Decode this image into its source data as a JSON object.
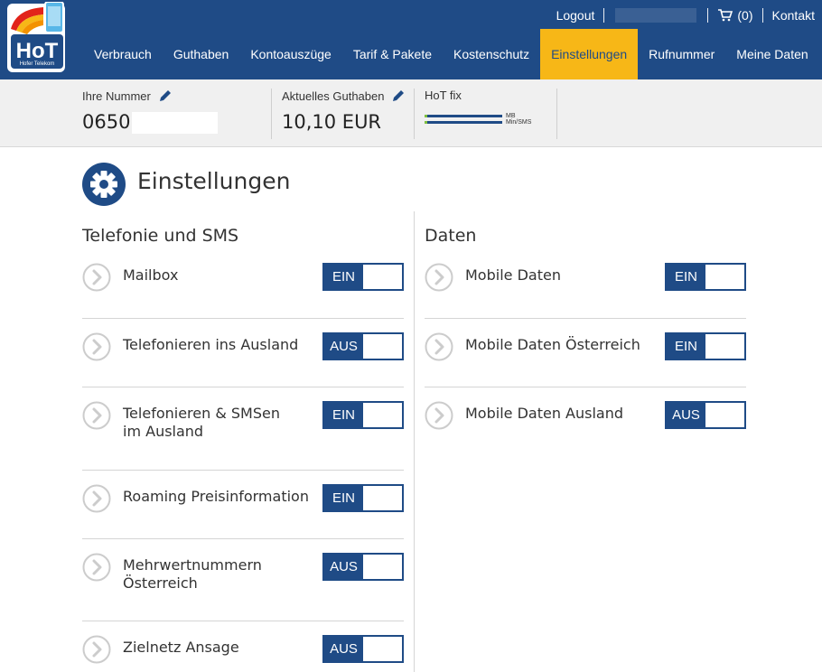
{
  "header": {
    "logo_text": "HoT",
    "logo_subtext": "Hofer Telekom",
    "logout": "Logout",
    "cart_count": "(0)",
    "contact": "Kontakt",
    "nav": [
      {
        "label": "Verbrauch",
        "active": false
      },
      {
        "label": "Guthaben",
        "active": false
      },
      {
        "label": "Kontoauszüge",
        "active": false
      },
      {
        "label": "Tarif & Pakete",
        "active": false
      },
      {
        "label": "Kostenschutz",
        "active": false
      },
      {
        "label": "Einstellungen",
        "active": true
      },
      {
        "label": "Rufnummer",
        "active": false
      },
      {
        "label": "Meine Daten",
        "active": false
      }
    ]
  },
  "infobar": {
    "number_label": "Ihre Nummer",
    "number_value": "0650",
    "balance_label": "Aktuelles Guthaben",
    "balance_value": "10,10 EUR",
    "plan_label": "HoT fix",
    "plan_bar_1": "MB",
    "plan_bar_2": "Min/SMS"
  },
  "page": {
    "title": "Einstellungen"
  },
  "telefonie": {
    "title": "Telefonie und SMS",
    "rows": [
      {
        "label": "Mailbox",
        "state": "EIN"
      },
      {
        "label": "Telefonieren ins Ausland",
        "state": "AUS"
      },
      {
        "label": "Telefonieren & SMSen\nim Ausland",
        "state": "EIN"
      },
      {
        "label": "Roaming Preisinformation",
        "state": "EIN"
      },
      {
        "label": "Mehrwertnummern\nÖsterreich",
        "state": "AUS"
      },
      {
        "label": "Zielnetz Ansage",
        "state": "AUS"
      }
    ]
  },
  "daten": {
    "title": "Daten",
    "rows": [
      {
        "label": "Mobile Daten",
        "state": "EIN"
      },
      {
        "label": "Mobile Daten Österreich",
        "state": "EIN"
      },
      {
        "label": "Mobile Daten Ausland",
        "state": "AUS"
      }
    ]
  },
  "colors": {
    "brand_blue": "#1f4b86",
    "active_nav": "#f7b717",
    "infobar_bg": "#f0f0f0"
  }
}
